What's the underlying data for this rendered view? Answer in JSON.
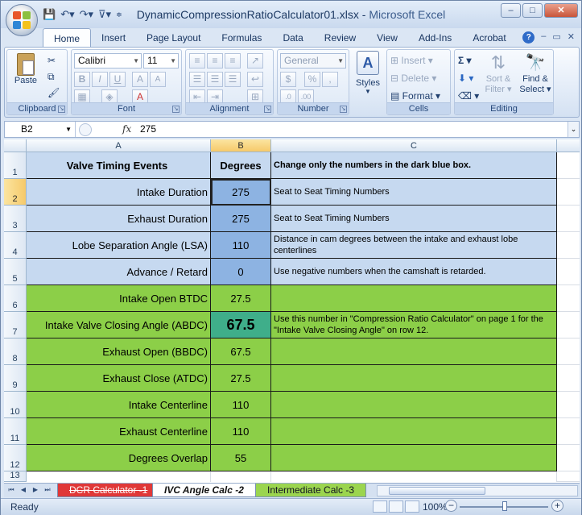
{
  "window": {
    "filename": "DynamicCompressionRatioCalculator01.xlsx",
    "separator": " - ",
    "app": "Microsoft Excel"
  },
  "ribbon_tabs": [
    "Home",
    "Insert",
    "Page Layout",
    "Formulas",
    "Data",
    "Review",
    "View",
    "Add-Ins",
    "Acrobat"
  ],
  "ribbon": {
    "clipboard": {
      "label": "Clipboard",
      "paste": "Paste"
    },
    "font": {
      "label": "Font",
      "name": "Calibri",
      "size": "11",
      "bold": "B",
      "italic": "I",
      "underline": "U"
    },
    "alignment": {
      "label": "Alignment"
    },
    "number": {
      "label": "Number",
      "format": "General",
      "currency": "$",
      "percent": "%",
      "comma": ",",
      "inc_dec": ".0",
      "dec_dec": ".00"
    },
    "styles": {
      "label": "Styles"
    },
    "cells": {
      "label": "Cells",
      "insert": "Insert",
      "delete": "Delete",
      "format": "Format"
    },
    "editing": {
      "label": "Editing",
      "sigma": "Σ",
      "sort_filter_1": "Sort &",
      "sort_filter_2": "Filter",
      "find_select_1": "Find &",
      "find_select_2": "Select"
    }
  },
  "formula_bar": {
    "name_box": "B2",
    "fx": "fx",
    "value": "275"
  },
  "columns": [
    "A",
    "B",
    "C"
  ],
  "rows": [
    {
      "num": "1",
      "a": "Valve Timing Events",
      "b": "Degrees",
      "c": "Change only the numbers in the dark blue box."
    },
    {
      "num": "2",
      "a": "Intake Duration",
      "b": "275",
      "c": "Seat to Seat Timing Numbers"
    },
    {
      "num": "3",
      "a": "Exhaust Duration",
      "b": "275",
      "c": "Seat to Seat Timing Numbers"
    },
    {
      "num": "4",
      "a": "Lobe Separation Angle  (LSA)",
      "b": "110",
      "c": "Distance in cam degrees between the intake and exhaust lobe centerlines"
    },
    {
      "num": "5",
      "a": "Advance / Retard",
      "b": "0",
      "c": "Use negative numbers when the camshaft is retarded."
    },
    {
      "num": "6",
      "a": "Intake Open BTDC",
      "b": "27.5",
      "c": ""
    },
    {
      "num": "7",
      "a": "Intake Valve Closing Angle (ABDC)",
      "b": "67.5",
      "c": "Use this number in \"Compression Ratio Calculator\" on page 1 for the \"Intake Valve Closing Angle\" on row 12."
    },
    {
      "num": "8",
      "a": "Exhaust Open (BBDC)",
      "b": "67.5",
      "c": ""
    },
    {
      "num": "9",
      "a": "Exhaust Close (ATDC)",
      "b": "27.5",
      "c": ""
    },
    {
      "num": "10",
      "a": "Intake Centerline",
      "b": "110",
      "c": ""
    },
    {
      "num": "11",
      "a": "Exhaust Centerline",
      "b": "110",
      "c": ""
    },
    {
      "num": "12",
      "a": "Degrees Overlap",
      "b": "55",
      "c": ""
    },
    {
      "num": "13",
      "a": "",
      "b": "",
      "c": ""
    }
  ],
  "sheet_tabs": [
    "DCR Calculator -1",
    "IVC Angle Calc -2",
    "Intermediate Calc -3"
  ],
  "status": {
    "ready": "Ready",
    "zoom": "100%",
    "minus": "−",
    "plus": "+"
  },
  "colors": {
    "light_blue": "#c6d9f0",
    "dark_blue": "#8db3e2",
    "green": "#8ccf48",
    "teal": "#3fae8a",
    "red_tab": "#e03838"
  }
}
